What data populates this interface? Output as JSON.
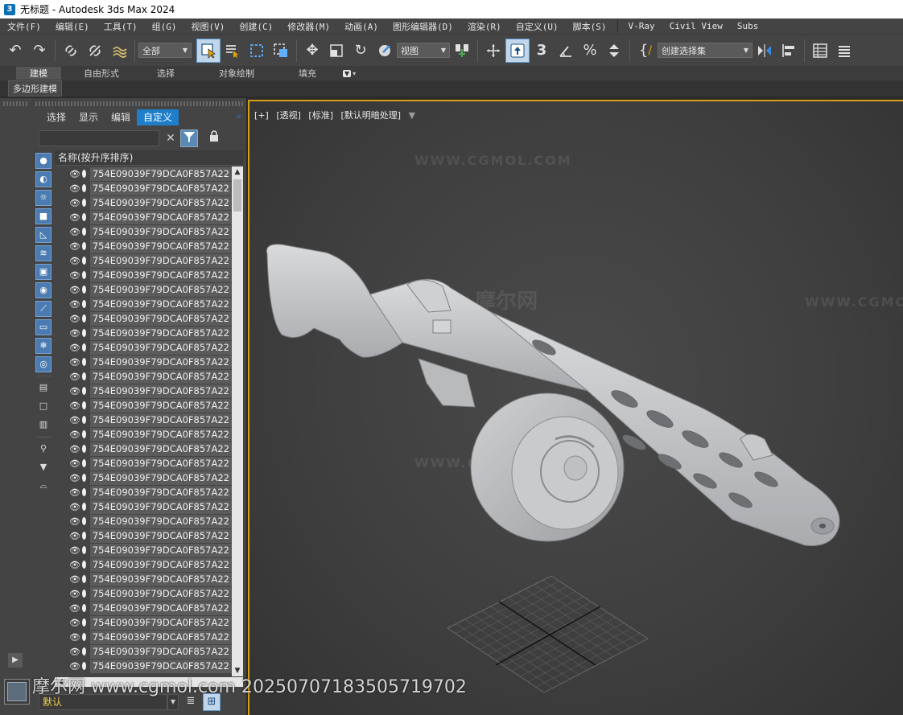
{
  "window": {
    "title": "无标题 - Autodesk 3ds Max 2024",
    "app_icon_text": "3"
  },
  "menu": [
    "文件(F)",
    "编辑(E)",
    "工具(T)",
    "组(G)",
    "视图(V)",
    "创建(C)",
    "修改器(M)",
    "动画(A)",
    "图形编辑器(D)",
    "渲染(R)",
    "自定义(U)",
    "脚本(S)",
    "V-Ray",
    "Civil View",
    "Subs"
  ],
  "toolbar": {
    "selection_filter": "全部",
    "reference_coord": "视图",
    "named_selection": "创建选择集"
  },
  "ribbon": {
    "tabs": [
      "建模",
      "自由形式",
      "选择",
      "对象绘制",
      "填充"
    ],
    "active_tab": "建模",
    "panel_label": "多边形建模"
  },
  "explorer": {
    "tabs": [
      "选择",
      "显示",
      "编辑",
      "自定义"
    ],
    "active_tab": "自定义",
    "column_header": "名称(按升序排序)",
    "object_name": "754E09039F79DCA0F857A22",
    "row_count": 35,
    "layer": "默认"
  },
  "viewport": {
    "labels": [
      "[+]",
      "[透视]",
      "[标准]",
      "[默认明暗处理]"
    ],
    "watermark_url": "WWW.CGMOL.COM",
    "watermark_cn": "摩尔网"
  },
  "watermark_footer": "摩尔网 www.cgmol.com 20250707183505719702",
  "colors": {
    "accent": "#1f7ec9",
    "viewport_border": "#d4a017",
    "layer_text": "#f2d14a"
  }
}
